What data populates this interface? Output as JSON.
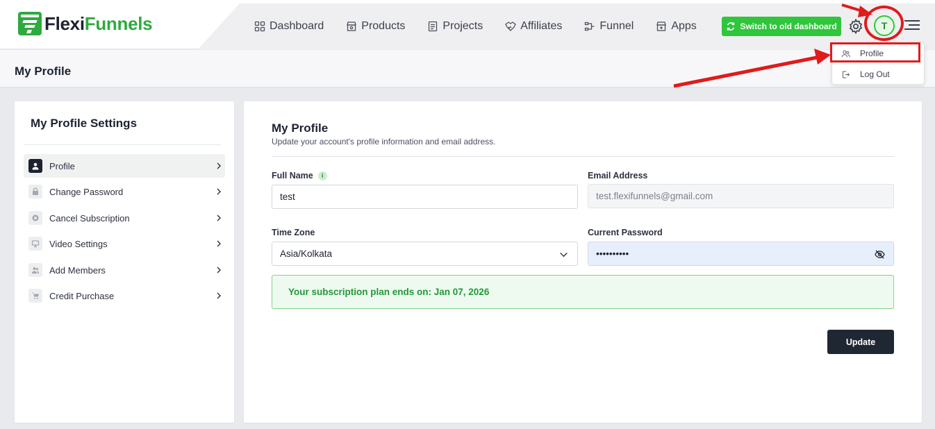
{
  "brand": {
    "name_part1": "Flexi",
    "name_part2": "Funnels",
    "accent": "#2eaa3f"
  },
  "nav": [
    {
      "label": "Dashboard",
      "icon": "grid-icon"
    },
    {
      "label": "Products",
      "icon": "store-icon"
    },
    {
      "label": "Projects",
      "icon": "document-icon"
    },
    {
      "label": "Affiliates",
      "icon": "handshake-icon"
    },
    {
      "label": "Funnel",
      "icon": "funnel-icon"
    },
    {
      "label": "Apps",
      "icon": "apps-store-icon"
    }
  ],
  "header_actions": {
    "switch_label": "Switch to old dashboard",
    "avatar_initial": "T"
  },
  "dropdown": {
    "profile_label": "Profile",
    "logout_label": "Log Out"
  },
  "page": {
    "title": "My Profile"
  },
  "sidebar": {
    "title": "My Profile Settings",
    "items": [
      {
        "label": "Profile",
        "icon": "user-icon",
        "active": true
      },
      {
        "label": "Change Password",
        "icon": "lock-icon"
      },
      {
        "label": "Cancel Subscription",
        "icon": "cancel-icon"
      },
      {
        "label": "Video Settings",
        "icon": "monitor-icon"
      },
      {
        "label": "Add Members",
        "icon": "users-icon"
      },
      {
        "label": "Credit Purchase",
        "icon": "cart-icon"
      }
    ]
  },
  "profile_form": {
    "title": "My Profile",
    "subtitle": "Update your account's profile information and email address.",
    "full_name_label": "Full Name",
    "full_name_value": "test",
    "info_glyph": "i",
    "email_label": "Email Address",
    "email_value": "test.flexifunnels@gmail.com",
    "timezone_label": "Time Zone",
    "timezone_value": "Asia/Kolkata",
    "password_label": "Current Password",
    "password_value": "••••••••••",
    "subscription_text": "Your subscription plan ends on: Jan 07, 2026",
    "update_label": "Update"
  },
  "colors": {
    "success_green": "#2fc63b",
    "dark_button": "#1f2733",
    "annotation_red": "#e01b1b"
  }
}
